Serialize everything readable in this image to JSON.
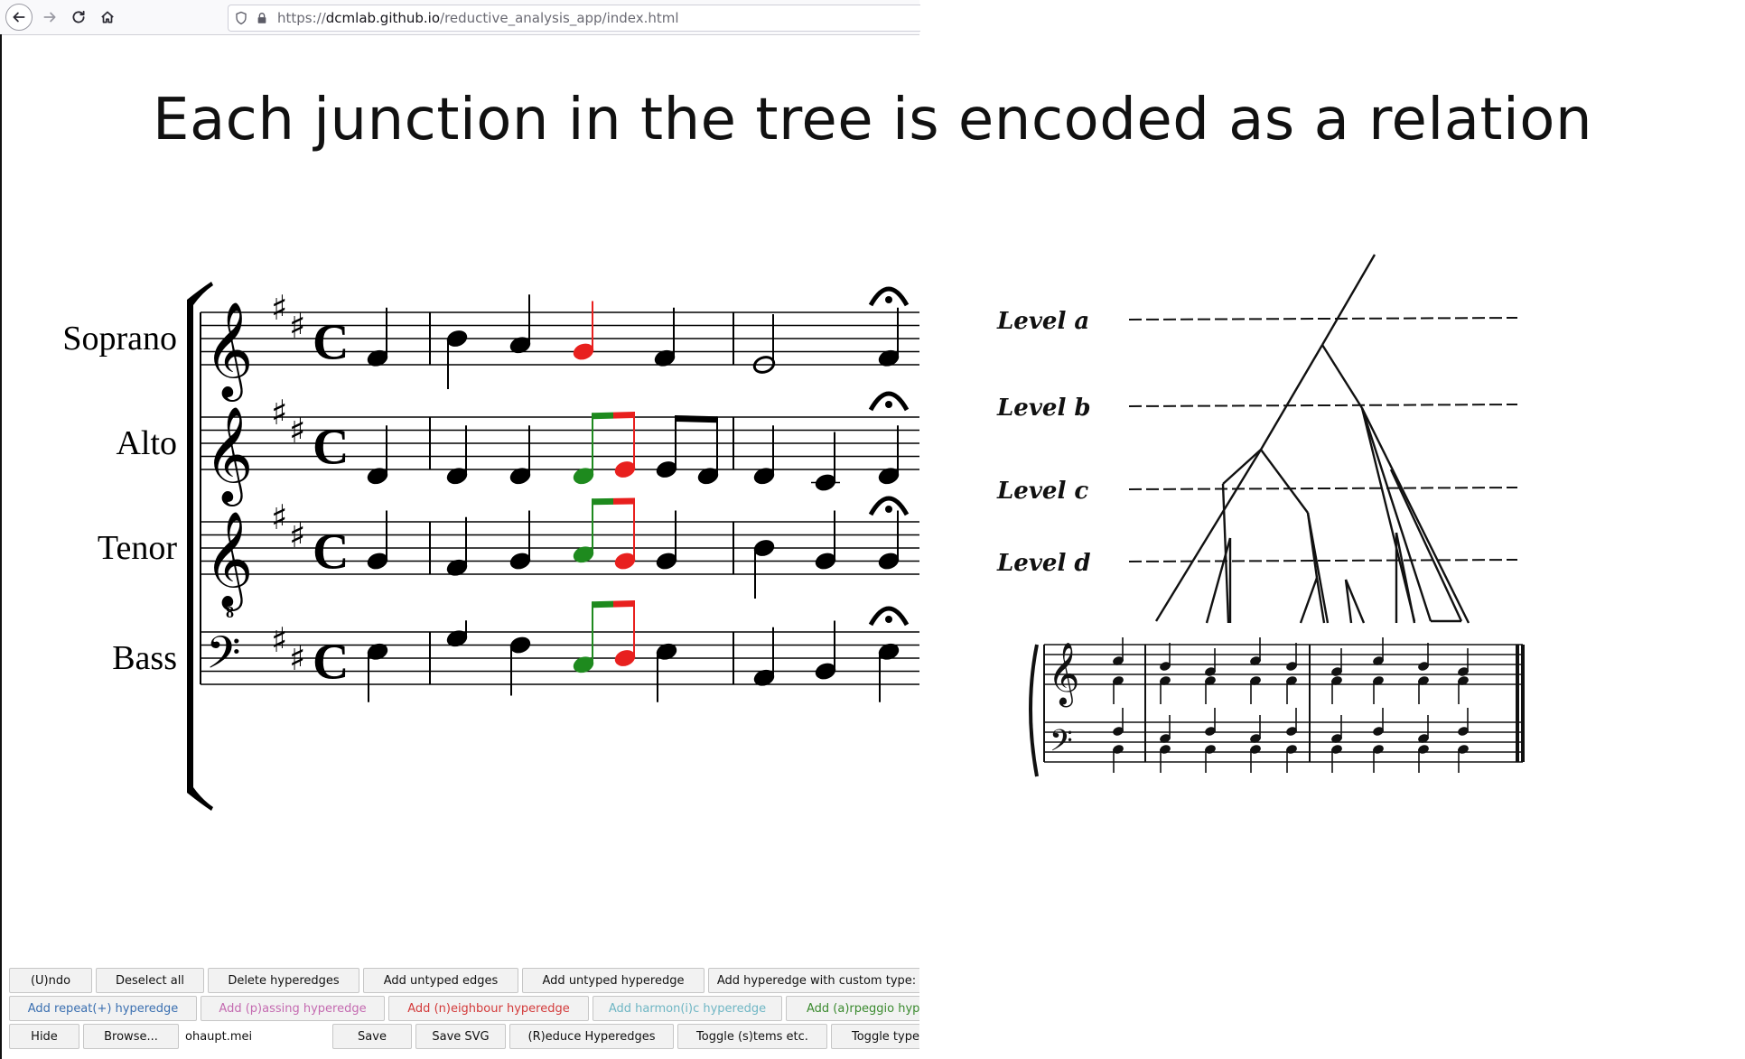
{
  "browser": {
    "url_prefix": "https://",
    "url_host": "dcmlab.github.io",
    "url_path": "/reductive_analysis_app/index.html"
  },
  "slide": {
    "title": "Each junction in the tree is encoded as a relation"
  },
  "score": {
    "staves": [
      {
        "label": "Soprano"
      },
      {
        "label": "Alto"
      },
      {
        "label": "Tenor"
      },
      {
        "label": "Bass"
      }
    ],
    "highlight_colors": {
      "green": "#1e8a1e",
      "red": "#e8201e"
    }
  },
  "figure": {
    "levels": [
      "Level a",
      "Level b",
      "Level c",
      "Level d"
    ]
  },
  "toolbar": {
    "row1": {
      "undo": "(U)ndo",
      "deselect_all": "Deselect all",
      "delete_hyperedges": "Delete hyperedges",
      "add_untyped_edges": "Add untyped edges",
      "add_untyped_hyperedge": "Add untyped hyperedge",
      "add_custom_hyperedge": "Add hyperedge with custom type:"
    },
    "row2": {
      "add_repeat": {
        "label": "Add repeat(+) hyperedge",
        "color": "#3a6fb0"
      },
      "add_passing": {
        "label": "Add (p)assing hyperedge",
        "color": "#c46ab0"
      },
      "add_neighbour": {
        "label": "Add (n)eighbour hyperedge",
        "color": "#d33a3a"
      },
      "add_harmonic": {
        "label": "Add harmon(i)c hyperedge",
        "color": "#6fb6c4"
      },
      "add_arpeggio": {
        "label": "Add (a)rpeggio hyperedge",
        "color": "#3a8a2e"
      }
    },
    "row3": {
      "hide": "Hide",
      "browse": "Browse...",
      "filename": "ohaupt.mei",
      "save": "Save",
      "save_svg": "Save SVG",
      "reduce_hyperedges": "(R)educe Hyperedges",
      "toggle_stems": "Toggle (s)tems etc.",
      "toggle_type": "Toggle type"
    }
  }
}
